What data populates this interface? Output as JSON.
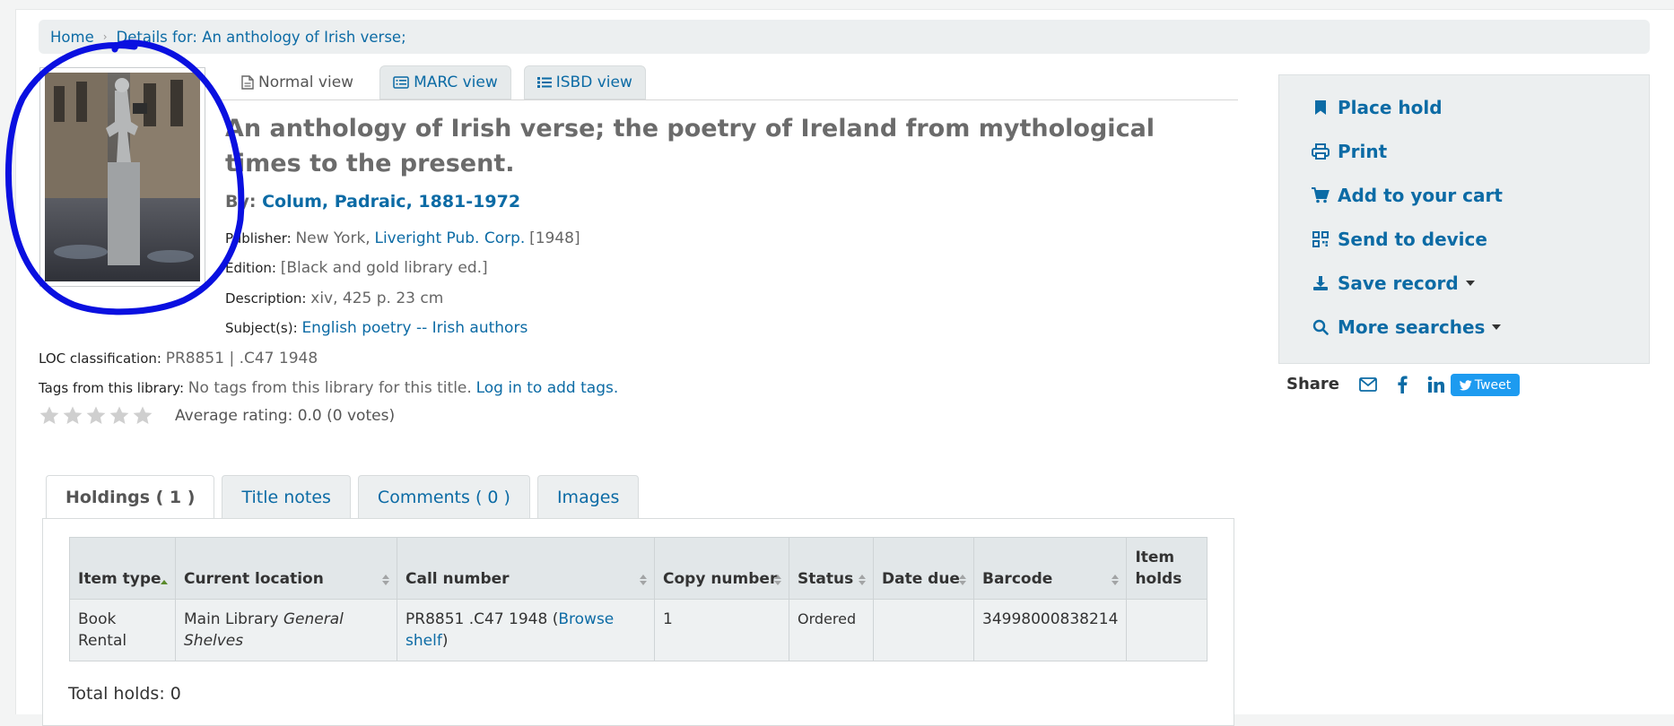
{
  "breadcrumb": {
    "home": "Home",
    "separator": "›",
    "current": "Details for: An anthology of Irish verse;"
  },
  "views": {
    "normal": "Normal view",
    "marc": "MARC view",
    "isbd": "ISBD view"
  },
  "record": {
    "title": "An anthology of Irish verse; the poetry of Ireland from mythological times to the present.",
    "by_label": "By:",
    "author": "Colum, Padraic, 1881-1972",
    "publisher_label": "Publisher:",
    "publisher_place": "New York,",
    "publisher_name": "Liveright Pub. Corp.",
    "publisher_year": "[1948]",
    "edition_label": "Edition:",
    "edition": "[Black and gold library ed.]",
    "description_label": "Description:",
    "description": "xiv, 425 p. 23 cm",
    "subjects_label": "Subject(s):",
    "subjects": "English poetry -- Irish authors",
    "loc_label": "LOC classification:",
    "loc": "PR8851 | .C47 1948",
    "tags_label": "Tags from this library:",
    "tags_text": "No tags from this library for this title.",
    "tags_login": "Log in to add tags.",
    "rating_stars": 0,
    "rating_max": 5,
    "rating_text": "Average rating: 0.0 (0 votes)"
  },
  "actions": {
    "place_hold": "Place hold",
    "print": "Print",
    "add_cart": "Add to your cart",
    "send_device": "Send to device",
    "save_record": "Save record",
    "more_searches": "More searches"
  },
  "share": {
    "label": "Share",
    "tweet": "Tweet"
  },
  "holdings_tabs": {
    "holdings": "Holdings ( 1 )",
    "title_notes": "Title notes",
    "comments": "Comments ( 0 )",
    "images": "Images"
  },
  "holdings": {
    "columns": [
      "Item type",
      "Current location",
      "Call number",
      "Copy number",
      "Status",
      "Date due",
      "Barcode",
      "Item holds"
    ],
    "row": {
      "item_type": "Book Rental",
      "location": "Main Library",
      "location_shelf": "General Shelves",
      "call_number": "PR8851 .C47 1948",
      "browse": "Browse shelf",
      "copy_number": "1",
      "status": "Ordered",
      "date_due": "",
      "barcode": "34998000838214",
      "item_holds": ""
    },
    "total_holds": "Total holds: 0"
  },
  "colors": {
    "link": "#0c6ba5",
    "annotation": "#0a10e0",
    "tweet": "#1d9bf0"
  }
}
